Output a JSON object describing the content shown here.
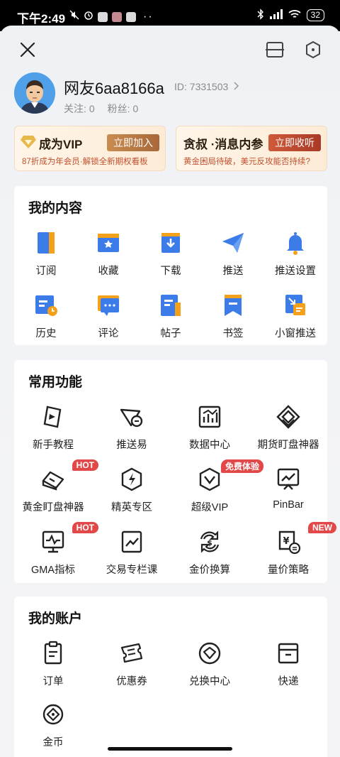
{
  "status_bar": {
    "time": "下午2:49",
    "battery": "32"
  },
  "profile": {
    "username": "网友6aa8166a",
    "id_label": "ID: 7331503",
    "following_label": "关注:",
    "following_count": "0",
    "fans_label": "粉丝:",
    "fans_count": "0"
  },
  "banners": {
    "vip": {
      "title": "成为VIP",
      "button": "立即加入",
      "subtitle": "87折成为年会员·解锁全新期权看板"
    },
    "news": {
      "title": "贪叔 ·消息内参",
      "button": "立即收听",
      "subtitle": "黄金困局待破，美元反攻能否持续?"
    }
  },
  "my_content": {
    "title": "我的内容",
    "items": [
      {
        "label": "订阅",
        "icon": "bookmark-book-icon"
      },
      {
        "label": "收藏",
        "icon": "star-folder-icon"
      },
      {
        "label": "下载",
        "icon": "download-icon"
      },
      {
        "label": "推送",
        "icon": "paper-plane-icon"
      },
      {
        "label": "推送设置",
        "icon": "bell-icon"
      },
      {
        "label": "历史",
        "icon": "history-icon"
      },
      {
        "label": "评论",
        "icon": "comment-icon"
      },
      {
        "label": "帖子",
        "icon": "post-icon"
      },
      {
        "label": "书签",
        "icon": "bookmark-icon"
      },
      {
        "label": "小窗推送",
        "icon": "mini-window-icon"
      }
    ]
  },
  "common_functions": {
    "title": "常用功能",
    "items": [
      {
        "label": "新手教程",
        "icon": "tutorial-icon",
        "badge": ""
      },
      {
        "label": "推送易",
        "icon": "push-easy-icon",
        "badge": ""
      },
      {
        "label": "数据中心",
        "icon": "data-center-icon",
        "badge": ""
      },
      {
        "label": "期货盯盘神器",
        "icon": "futures-monitor-icon",
        "badge": ""
      },
      {
        "label": "黄金盯盘神器",
        "icon": "gold-monitor-icon",
        "badge": "HOT"
      },
      {
        "label": "精英专区",
        "icon": "elite-icon",
        "badge": ""
      },
      {
        "label": "超级VIP",
        "icon": "super-vip-icon",
        "badge": "免费体验"
      },
      {
        "label": "PinBar",
        "icon": "pinbar-icon",
        "badge": ""
      },
      {
        "label": "GMA指标",
        "icon": "gma-indicator-icon",
        "badge": "HOT"
      },
      {
        "label": "交易专栏课",
        "icon": "trading-course-icon",
        "badge": ""
      },
      {
        "label": "金价换算",
        "icon": "gold-price-convert-icon",
        "badge": ""
      },
      {
        "label": "量价策略",
        "icon": "volume-price-strategy-icon",
        "badge": "NEW"
      }
    ]
  },
  "my_account": {
    "title": "我的账户",
    "items": [
      {
        "label": "订单",
        "icon": "order-icon"
      },
      {
        "label": "优惠券",
        "icon": "coupon-icon"
      },
      {
        "label": "兑换中心",
        "icon": "exchange-center-icon"
      },
      {
        "label": "快递",
        "icon": "delivery-box-icon"
      },
      {
        "label": "金币",
        "icon": "gold-coin-icon"
      }
    ]
  },
  "colors": {
    "blue": "#3b7ce8",
    "orange": "#f3a01a",
    "red_badge": "#e34848",
    "vip_gold": "#b8783e"
  }
}
